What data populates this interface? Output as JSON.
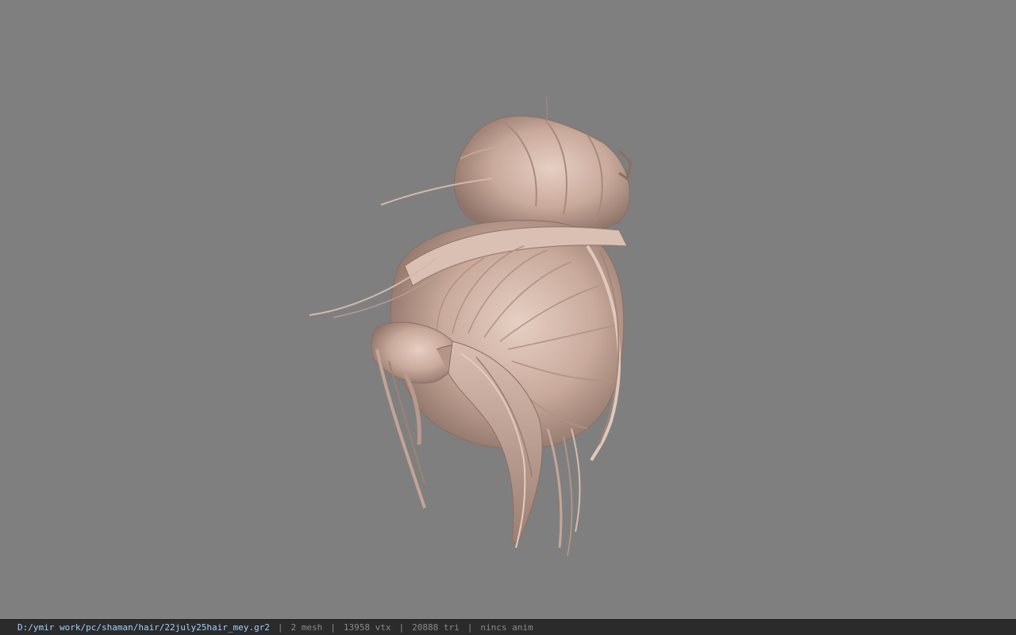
{
  "viewport": {
    "background_color": "#7f7f7f",
    "model_color": "#c9aa9c",
    "model": "hair-mesh"
  },
  "status_bar": {
    "file_path": "D:/ymir work/pc/shaman/hair/22july25hair_mey.gr2",
    "separator": "|",
    "mesh_count": "2 mesh",
    "vertex_count": "13958 vtx",
    "triangle_count": "20888 tri",
    "anim_status": "nincs anim"
  }
}
